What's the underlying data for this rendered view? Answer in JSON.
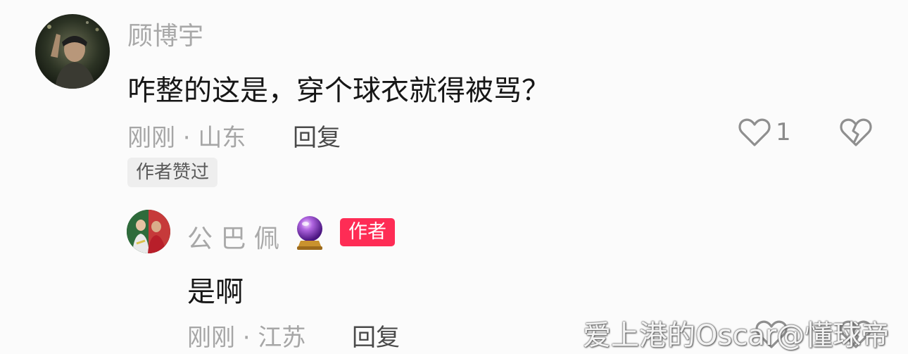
{
  "comment": {
    "username": "顾博宇",
    "text": "咋整的这是，穿个球衣就得被骂？",
    "meta": "刚刚 · 山东",
    "reply_label": "回复",
    "like_count": "1",
    "liked_badge": "作者赞过"
  },
  "reply": {
    "username": "公 巴 佩",
    "author_badge": "作者",
    "text": "是啊",
    "meta": "刚刚 · 江苏",
    "reply_label": "回复"
  },
  "watermark": "爱上港的Oscar@懂球帝",
  "colors": {
    "background": "#fbfbfb",
    "author_badge": "#fe2c55",
    "text_primary": "#161616",
    "text_secondary": "#a8a8a8"
  },
  "icons": {
    "like": "heart-outline-icon",
    "dislike": "broken-heart-icon",
    "user_decoration": "crystal-ball-icon"
  }
}
